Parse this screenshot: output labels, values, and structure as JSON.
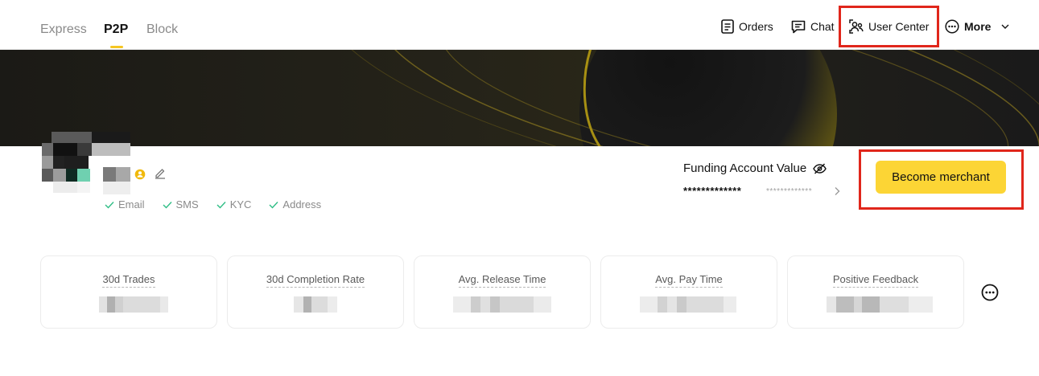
{
  "nav": {
    "tabs": [
      {
        "label": "Express",
        "active": false
      },
      {
        "label": "P2P",
        "active": true
      },
      {
        "label": "Block",
        "active": false
      }
    ],
    "actions": {
      "orders": "Orders",
      "chat": "Chat",
      "user_center": "User Center",
      "more": "More"
    }
  },
  "profile": {
    "verifications": [
      "Email",
      "SMS",
      "KYC",
      "Address"
    ]
  },
  "funding": {
    "label": "Funding Account Value",
    "value": "*************",
    "sub_value": "*************",
    "merchant_button": "Become merchant"
  },
  "stats": [
    {
      "label": "30d Trades"
    },
    {
      "label": "30d Completion Rate"
    },
    {
      "label": "Avg. Release Time"
    },
    {
      "label": "Avg. Pay Time"
    },
    {
      "label": "Positive Feedback"
    }
  ],
  "colors": {
    "accent": "#fcd535",
    "tab_indicator": "#f5c623",
    "highlight": "#e0261b",
    "verified": "#2ebd85"
  }
}
